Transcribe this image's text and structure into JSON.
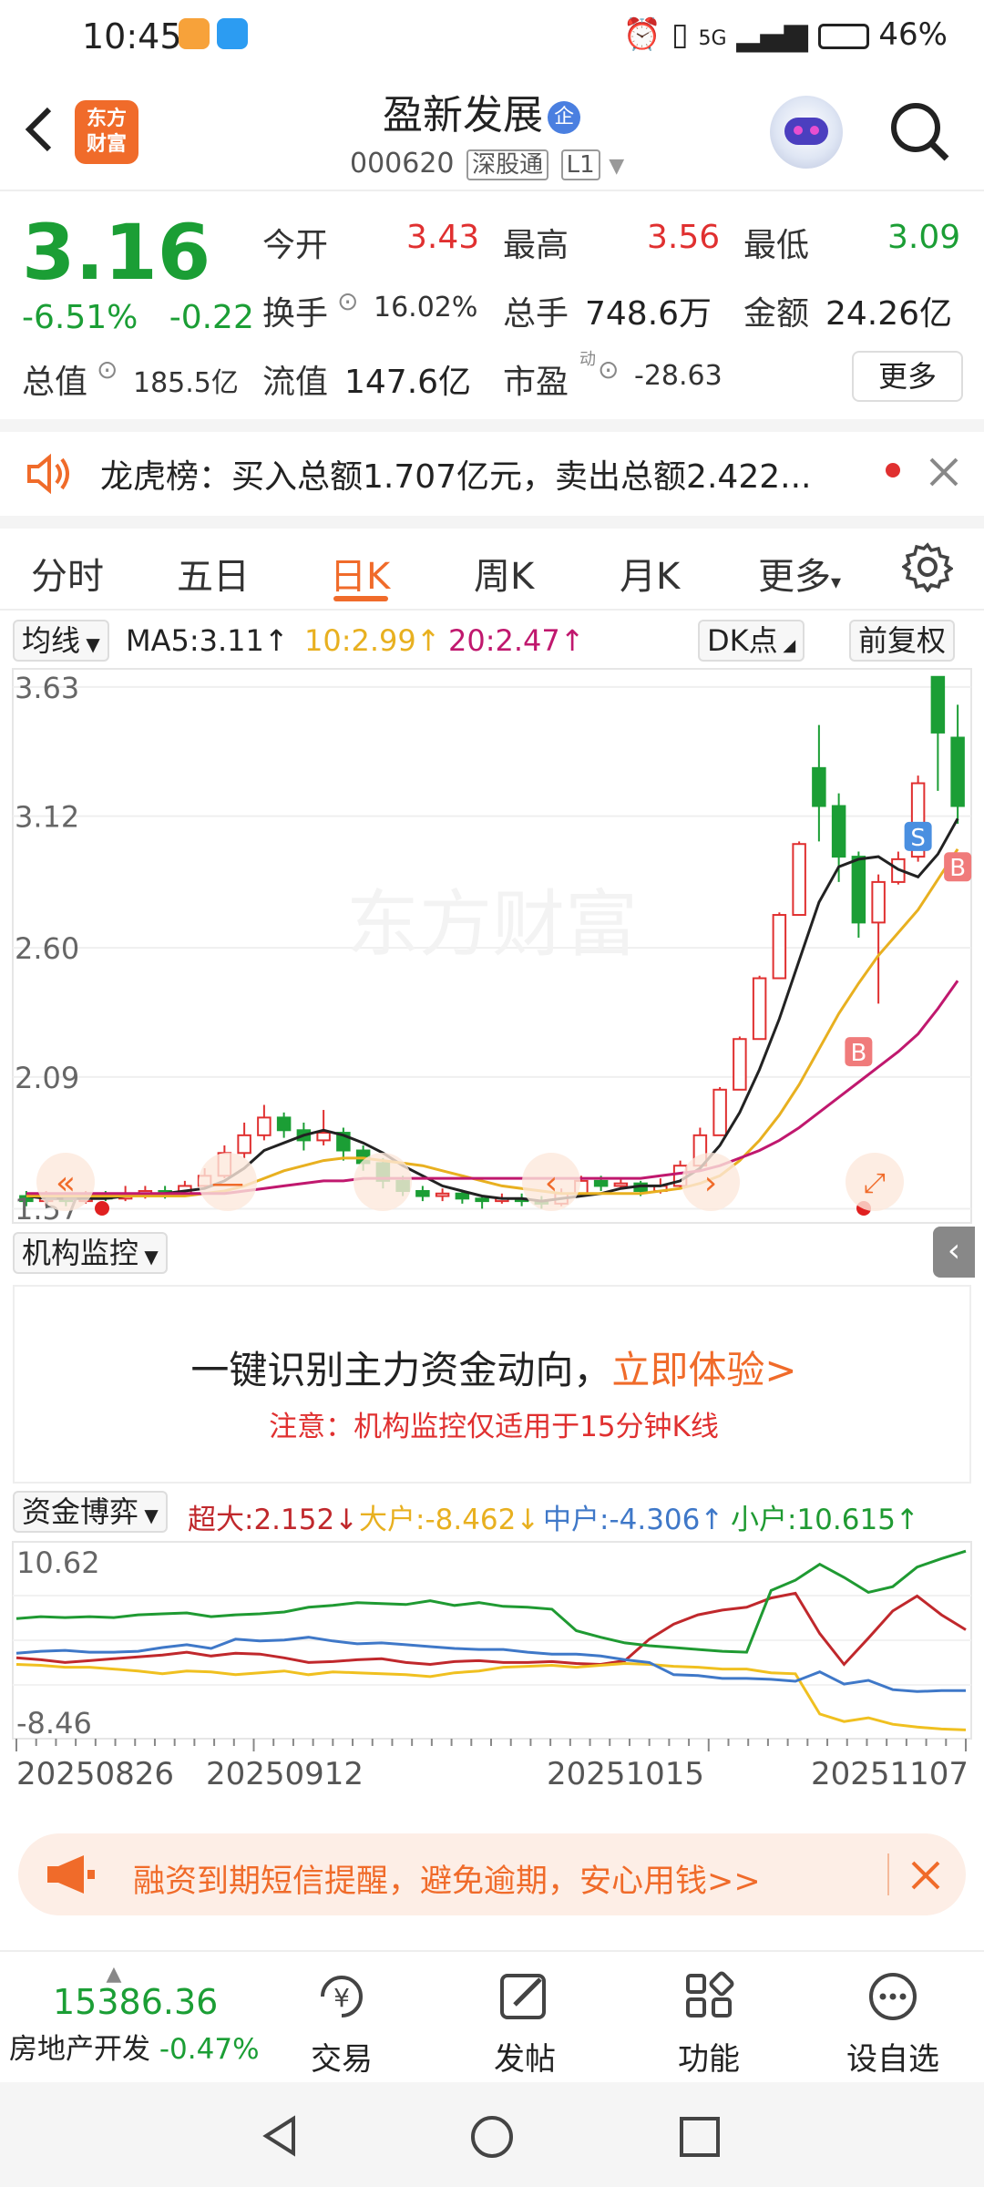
{
  "status_bar": {
    "time": "10:45",
    "network": "5G",
    "battery": "46%"
  },
  "header": {
    "logo_text_line1": "东方",
    "logo_text_line2": "财富",
    "stock_name": "盈新发展",
    "badge": "企",
    "code": "000620",
    "tag_connect": "深股通",
    "tag_level": "L1"
  },
  "quote": {
    "price": "3.16",
    "change_pct": "-6.51%",
    "change_abs": "-0.22",
    "open_label": "今开",
    "open_value": "3.43",
    "high_label": "最高",
    "high_value": "3.56",
    "low_label": "最低",
    "low_value": "3.09",
    "turnover_label": "换手",
    "turnover_value": "16.02%",
    "volume_label": "总手",
    "volume_value": "748.6万",
    "amount_label": "金额",
    "amount_value": "24.26亿",
    "total_cap_label": "总值",
    "total_cap_value": "185.5亿",
    "float_cap_label": "流值",
    "float_cap_value": "147.6亿",
    "pe_label": "市盈",
    "pe_sup": "动",
    "pe_value": "-28.63",
    "more_label": "更多"
  },
  "notice": {
    "text": "龙虎榜：买入总额1.707亿元，卖出总额2.422..."
  },
  "tabs": [
    "分时",
    "五日",
    "日K",
    "周K",
    "月K",
    "更多"
  ],
  "ma": {
    "selector": "均线",
    "ma5": "MA5:3.11↑",
    "ma10": "10:2.99↑",
    "ma20": "20:2.47↑",
    "dk_label": "DK点",
    "adjust_label": "前复权",
    "colors": {
      "ma5": "#222222",
      "ma10": "#e8b020",
      "ma20": "#c0186e"
    }
  },
  "chart_data": {
    "type": "candlestick",
    "watermark": "东方财富",
    "y_ticks": [
      "3.63",
      "3.12",
      "2.60",
      "2.09",
      "1.57"
    ],
    "ylim": [
      1.55,
      3.68
    ],
    "candles": [
      [
        1.62,
        1.6,
        1.64,
        1.58
      ],
      [
        1.6,
        1.62,
        1.64,
        1.58
      ],
      [
        1.61,
        1.6,
        1.63,
        1.58
      ],
      [
        1.6,
        1.62,
        1.64,
        1.59
      ],
      [
        1.62,
        1.61,
        1.64,
        1.6
      ],
      [
        1.61,
        1.63,
        1.66,
        1.6
      ],
      [
        1.63,
        1.64,
        1.66,
        1.61
      ],
      [
        1.64,
        1.63,
        1.66,
        1.61
      ],
      [
        1.63,
        1.66,
        1.68,
        1.62
      ],
      [
        1.66,
        1.7,
        1.73,
        1.65
      ],
      [
        1.7,
        1.79,
        1.82,
        1.69
      ],
      [
        1.79,
        1.86,
        1.91,
        1.77
      ],
      [
        1.86,
        1.93,
        1.98,
        1.84
      ],
      [
        1.93,
        1.88,
        1.95,
        1.85
      ],
      [
        1.88,
        1.84,
        1.91,
        1.8
      ],
      [
        1.84,
        1.87,
        1.96,
        1.82
      ],
      [
        1.87,
        1.8,
        1.89,
        1.76
      ],
      [
        1.8,
        1.75,
        1.82,
        1.72
      ],
      [
        1.75,
        1.68,
        1.77,
        1.65
      ],
      [
        1.68,
        1.64,
        1.7,
        1.62
      ],
      [
        1.64,
        1.62,
        1.66,
        1.6
      ],
      [
        1.62,
        1.63,
        1.65,
        1.6
      ],
      [
        1.63,
        1.61,
        1.64,
        1.59
      ],
      [
        1.61,
        1.6,
        1.62,
        1.57
      ],
      [
        1.6,
        1.61,
        1.63,
        1.59
      ],
      [
        1.61,
        1.6,
        1.63,
        1.58
      ],
      [
        1.6,
        1.59,
        1.62,
        1.57
      ],
      [
        1.59,
        1.63,
        1.65,
        1.58
      ],
      [
        1.63,
        1.68,
        1.7,
        1.62
      ],
      [
        1.68,
        1.66,
        1.7,
        1.64
      ],
      [
        1.66,
        1.67,
        1.69,
        1.65
      ],
      [
        1.67,
        1.64,
        1.68,
        1.62
      ],
      [
        1.64,
        1.66,
        1.69,
        1.63
      ],
      [
        1.66,
        1.74,
        1.76,
        1.65
      ],
      [
        1.74,
        1.86,
        1.89,
        1.73
      ],
      [
        1.86,
        2.04,
        2.05,
        1.86
      ],
      [
        2.04,
        2.24,
        2.25,
        2.04
      ],
      [
        2.24,
        2.48,
        2.49,
        2.24
      ],
      [
        2.48,
        2.73,
        2.74,
        2.48
      ],
      [
        2.73,
        3.01,
        3.02,
        2.73
      ],
      [
        3.31,
        3.16,
        3.48,
        3.02
      ],
      [
        3.16,
        2.96,
        3.21,
        2.86
      ],
      [
        2.96,
        2.7,
        2.98,
        2.64
      ],
      [
        2.7,
        2.86,
        2.89,
        2.38
      ],
      [
        2.86,
        2.95,
        2.98,
        2.85
      ],
      [
        2.96,
        3.25,
        3.28,
        2.94
      ],
      [
        3.67,
        3.45,
        3.67,
        3.22
      ],
      [
        3.43,
        3.16,
        3.56,
        3.09
      ]
    ],
    "ma5": [
      1.62,
      1.61,
      1.61,
      1.61,
      1.61,
      1.62,
      1.62,
      1.63,
      1.64,
      1.65,
      1.68,
      1.73,
      1.8,
      1.83,
      1.86,
      1.88,
      1.86,
      1.83,
      1.79,
      1.74,
      1.7,
      1.66,
      1.64,
      1.62,
      1.61,
      1.61,
      1.6,
      1.61,
      1.62,
      1.63,
      1.65,
      1.66,
      1.66,
      1.68,
      1.73,
      1.82,
      1.95,
      2.12,
      2.32,
      2.55,
      2.78,
      2.92,
      2.95,
      2.96,
      2.91,
      2.88,
      2.97,
      3.11
    ],
    "ma10": [
      1.62,
      1.62,
      1.62,
      1.62,
      1.62,
      1.62,
      1.62,
      1.62,
      1.62,
      1.63,
      1.64,
      1.66,
      1.69,
      1.72,
      1.74,
      1.76,
      1.77,
      1.77,
      1.76,
      1.75,
      1.74,
      1.72,
      1.7,
      1.68,
      1.66,
      1.65,
      1.64,
      1.63,
      1.63,
      1.63,
      1.63,
      1.63,
      1.64,
      1.65,
      1.67,
      1.7,
      1.76,
      1.84,
      1.94,
      2.06,
      2.2,
      2.34,
      2.46,
      2.57,
      2.66,
      2.75,
      2.87,
      2.99
    ],
    "ma20": [
      1.63,
      1.63,
      1.63,
      1.63,
      1.63,
      1.63,
      1.63,
      1.63,
      1.63,
      1.63,
      1.63,
      1.64,
      1.65,
      1.66,
      1.67,
      1.68,
      1.68,
      1.69,
      1.69,
      1.69,
      1.69,
      1.69,
      1.69,
      1.69,
      1.69,
      1.69,
      1.69,
      1.69,
      1.69,
      1.69,
      1.69,
      1.69,
      1.7,
      1.71,
      1.72,
      1.74,
      1.77,
      1.8,
      1.84,
      1.89,
      1.95,
      2.01,
      2.07,
      2.13,
      2.19,
      2.26,
      2.36,
      2.47
    ],
    "markers": [
      {
        "label": "S",
        "color": "#4a8fe0"
      },
      {
        "label": "B",
        "color": "#f07b7b"
      },
      {
        "label": "B",
        "color": "#f07b7b"
      }
    ]
  },
  "institution": {
    "selector": "机构监控",
    "title_main": "一键识别主力资金动向，",
    "title_cta": "立即体验>",
    "note": "注意：机构监控仅适用于15分钟K线"
  },
  "fund_flow": {
    "selector": "资金博弈",
    "super_label": "超大:2.152↓",
    "large_label": "大户:-8.462↓",
    "mid_label": "中户:-4.306↑",
    "small_label": "小户:10.615↑",
    "y_max": "10.62",
    "y_min": "-8.46",
    "dates": [
      "20250826",
      "20250912",
      "20251015",
      "20251107"
    ],
    "colors": {
      "super": "#c0282c",
      "large": "#f0c020",
      "mid": "#3f78c8",
      "small": "#1f9a32"
    },
    "chart_data": {
      "type": "line",
      "ylim": [
        -8.46,
        10.62
      ],
      "series": [
        {
          "name": "超大",
          "values": [
            -0.8,
            -1.0,
            -1.3,
            -1.1,
            -0.9,
            -0.7,
            -0.5,
            -0.2,
            -0.6,
            -0.3,
            -0.4,
            -0.8,
            -1.3,
            -1.2,
            -1.0,
            -0.9,
            -1.3,
            -1.5,
            -1.2,
            -1.1,
            -1.3,
            -1.3,
            -1.2,
            -1.4,
            -1.5,
            -1.1,
            1.2,
            2.8,
            3.8,
            4.3,
            4.6,
            5.6,
            6.1,
            1.8,
            -1.5,
            1.3,
            4.2,
            5.8,
            3.8,
            2.2
          ]
        },
        {
          "name": "大户",
          "values": [
            -1.5,
            -1.6,
            -1.8,
            -1.8,
            -2.0,
            -2.2,
            -2.5,
            -2.2,
            -2.3,
            -2.6,
            -2.4,
            -2.2,
            -2.6,
            -2.3,
            -2.4,
            -2.5,
            -2.6,
            -2.8,
            -2.4,
            -2.2,
            -1.8,
            -1.7,
            -1.6,
            -1.8,
            -1.6,
            -1.4,
            -1.5,
            -1.7,
            -1.8,
            -2.0,
            -2.0,
            -2.4,
            -2.5,
            -6.8,
            -7.6,
            -7.2,
            -7.9,
            -8.2,
            -8.4,
            -8.5
          ]
        },
        {
          "name": "中户",
          "values": [
            -0.3,
            -0.1,
            0.0,
            -0.2,
            -0.2,
            -0.1,
            0.3,
            0.6,
            0.2,
            1.2,
            1.0,
            1.1,
            1.4,
            1.0,
            0.7,
            0.8,
            0.6,
            0.4,
            0.2,
            0.1,
            0.1,
            -0.2,
            -0.4,
            -0.4,
            -0.6,
            -1.0,
            -1.3,
            -2.6,
            -2.7,
            -3.0,
            -3.0,
            -3.1,
            -3.3,
            -2.3,
            -3.6,
            -3.2,
            -4.2,
            -4.4,
            -4.3,
            -4.3
          ]
        },
        {
          "name": "小户",
          "values": [
            3.4,
            3.6,
            3.5,
            3.6,
            3.5,
            3.8,
            3.9,
            4.0,
            3.6,
            3.8,
            3.9,
            4.1,
            4.6,
            4.8,
            5.1,
            5.0,
            4.9,
            5.3,
            4.8,
            5.1,
            4.7,
            4.6,
            4.4,
            2.1,
            1.4,
            0.8,
            0.5,
            0.3,
            0.1,
            -0.1,
            -0.2,
            6.4,
            7.5,
            9.2,
            7.8,
            6.2,
            6.8,
            8.9,
            9.8,
            10.6
          ]
        }
      ]
    }
  },
  "banner": {
    "text": "融资到期短信提醒，避免逾期，安心用钱>>"
  },
  "bottom_bar": {
    "index_value": "15386.36",
    "index_name": "房地产开发",
    "index_change": "-0.47%",
    "items": [
      "交易",
      "发帖",
      "功能",
      "设自选"
    ]
  }
}
